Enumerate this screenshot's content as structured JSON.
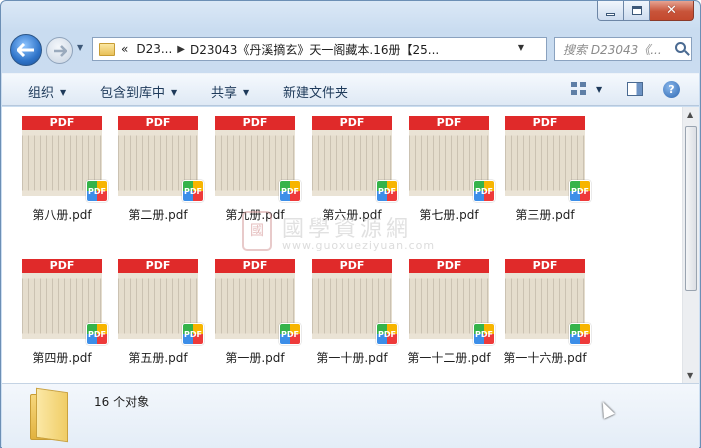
{
  "window": {
    "caption": {
      "minimize": "minimize",
      "maximize": "maximize",
      "close": "✕"
    }
  },
  "nav": {
    "address_chevron": "«",
    "crumb1": "D23...",
    "crumb2": "D23043《丹溪摘玄》天一阁藏本.16册【25..."
  },
  "search": {
    "placeholder": "搜索 D23043《..."
  },
  "toolbar": {
    "organize": "组织",
    "include_in_library": "包含到库中",
    "share": "共享",
    "new_folder": "新建文件夹"
  },
  "files": [
    {
      "name": "第八册.pdf"
    },
    {
      "name": "第二册.pdf"
    },
    {
      "name": "第九册.pdf"
    },
    {
      "name": "第六册.pdf"
    },
    {
      "name": "第七册.pdf"
    },
    {
      "name": "第三册.pdf"
    },
    {
      "name": "第四册.pdf"
    },
    {
      "name": "第五册.pdf"
    },
    {
      "name": "第一册.pdf"
    },
    {
      "name": "第一十册.pdf"
    },
    {
      "name": "第一十二册.pdf"
    },
    {
      "name": "第一十六册.pdf"
    }
  ],
  "thumb_band_label": "PDF",
  "badge_label": "PDF",
  "watermark": {
    "seal": "國",
    "title": "國學資源網",
    "url": "www.guoxueziyuan.com"
  },
  "status": {
    "count": "16 个对象"
  },
  "colors": {
    "pdf_red": "#e02a2a",
    "window_frame": "#6c8fb5",
    "close_button": "#c8543a"
  }
}
